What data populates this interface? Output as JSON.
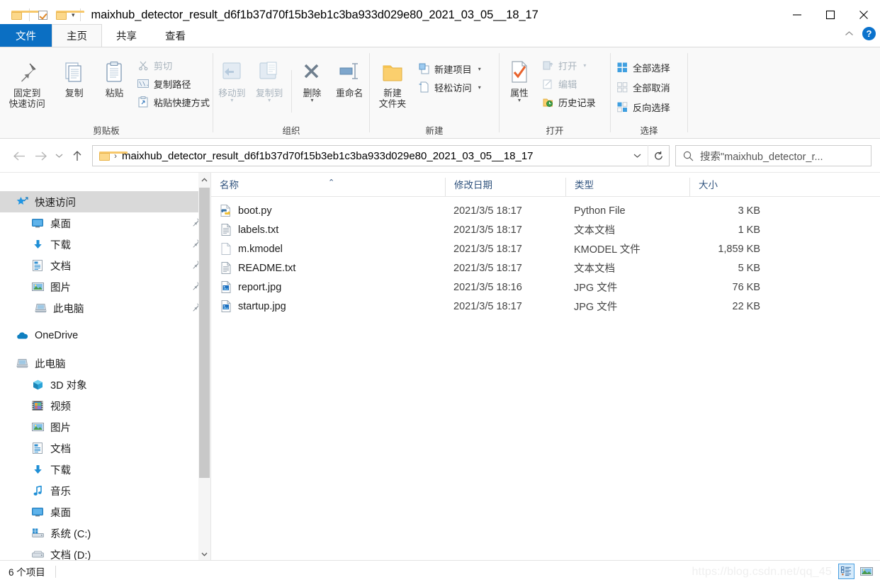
{
  "window": {
    "title": "maixhub_detector_result_d6f1b37d70f15b3eb1c3ba933d029e80_2021_03_05__18_17",
    "minimize_label": "—",
    "maximize_label": "□",
    "close_label": "✕"
  },
  "quick_access_toolbar": {
    "properties_icon": "folder-icon",
    "new_folder_icon": "checkbox-icon",
    "second_folder_icon": "folder-icon",
    "customize_caret": "▾"
  },
  "ribbon_tabs": [
    {
      "label": "文件",
      "id": "file"
    },
    {
      "label": "主页",
      "id": "home"
    },
    {
      "label": "共享",
      "id": "share"
    },
    {
      "label": "查看",
      "id": "view"
    }
  ],
  "ribbon_right": {
    "collapse_icon": "chevron-up-icon",
    "help_label": "?"
  },
  "ribbon": {
    "groups": [
      {
        "id": "clipboard",
        "label": "剪贴板",
        "big_buttons": [
          {
            "label": "固定到\n快速访问",
            "line1": "固定到",
            "line2": "快速访问",
            "icon": "pin-icon",
            "disabled": false
          },
          {
            "label": "复制",
            "line1": "复制",
            "line2": "",
            "icon": "copy-icon",
            "disabled": false
          },
          {
            "label": "粘贴",
            "line1": "粘贴",
            "line2": "",
            "icon": "paste-icon",
            "disabled": false
          }
        ],
        "small_buttons": [
          {
            "label": "剪切",
            "icon": "scissors-icon",
            "disabled": true
          },
          {
            "label": "复制路径",
            "icon": "copy-path-icon",
            "disabled": false
          },
          {
            "label": "粘贴快捷方式",
            "icon": "paste-shortcut-icon",
            "disabled": false
          }
        ]
      },
      {
        "id": "organize",
        "label": "组织",
        "big_buttons": [
          {
            "line1": "移动到",
            "line2": "",
            "icon": "move-to-icon",
            "disabled": true,
            "caret": true
          },
          {
            "line1": "复制到",
            "line2": "",
            "icon": "copy-to-icon",
            "disabled": true,
            "caret": true
          },
          {
            "line1": "删除",
            "line2": "",
            "icon": "delete-icon",
            "disabled": false,
            "caret": true
          },
          {
            "line1": "重命名",
            "line2": "",
            "icon": "rename-icon",
            "disabled": false,
            "caret": false
          }
        ],
        "small_buttons": []
      },
      {
        "id": "new",
        "label": "新建",
        "big_buttons": [
          {
            "line1": "新建",
            "line2": "文件夹",
            "icon": "new-folder-icon",
            "disabled": false
          }
        ],
        "small_buttons": [
          {
            "label": "新建项目",
            "icon": "new-item-icon",
            "disabled": false,
            "caret": true
          },
          {
            "label": "轻松访问",
            "icon": "easy-access-icon",
            "disabled": false,
            "caret": true
          }
        ]
      },
      {
        "id": "open",
        "label": "打开",
        "big_buttons": [
          {
            "line1": "属性",
            "line2": "",
            "icon": "properties-icon",
            "disabled": false,
            "caret": true
          }
        ],
        "small_buttons": [
          {
            "label": "打开",
            "icon": "open-icon",
            "disabled": true,
            "caret": true
          },
          {
            "label": "编辑",
            "icon": "edit-icon",
            "disabled": true
          },
          {
            "label": "历史记录",
            "icon": "history-icon",
            "disabled": false
          }
        ]
      },
      {
        "id": "select",
        "label": "选择",
        "big_buttons": [],
        "small_buttons": [
          {
            "label": "全部选择",
            "icon": "select-all-icon",
            "disabled": false
          },
          {
            "label": "全部取消",
            "icon": "select-none-icon",
            "disabled": false
          },
          {
            "label": "反向选择",
            "icon": "invert-selection-icon",
            "disabled": false
          }
        ]
      }
    ]
  },
  "addressbar": {
    "back_icon": "arrow-left-icon",
    "forward_icon": "arrow-right-icon",
    "recent_icon": "chevron-down-icon",
    "up_icon": "arrow-up-icon",
    "path_icon": "folder-icon",
    "separator": "›",
    "path": "maixhub_detector_result_d6f1b37d70f15b3eb1c3ba933d029e80_2021_03_05__18_17",
    "dropdown_icon": "chevron-down-icon",
    "refresh_icon": "refresh-icon"
  },
  "search": {
    "icon": "search-icon",
    "placeholder": "搜索\"maixhub_detector_r..."
  },
  "sidebar": {
    "groups": [
      {
        "header": {
          "label": "快速访问",
          "icon": "star-pin-icon",
          "selected": true
        },
        "items": [
          {
            "label": "桌面",
            "icon": "desktop-icon",
            "pinned": true
          },
          {
            "label": "下载",
            "icon": "download-icon",
            "pinned": true
          },
          {
            "label": "文档",
            "icon": "documents-icon",
            "pinned": true
          },
          {
            "label": "图片",
            "icon": "pictures-icon",
            "pinned": true
          },
          {
            "label": "此电脑",
            "icon": "this-pc-icon",
            "pinned": true
          }
        ]
      },
      {
        "header": {
          "label": "OneDrive",
          "icon": "onedrive-icon",
          "selected": false
        },
        "items": []
      },
      {
        "header": {
          "label": "此电脑",
          "icon": "this-pc-icon",
          "selected": false
        },
        "items": [
          {
            "label": "3D 对象",
            "icon": "3d-objects-icon",
            "pinned": false
          },
          {
            "label": "视频",
            "icon": "videos-icon",
            "pinned": false
          },
          {
            "label": "图片",
            "icon": "pictures-icon",
            "pinned": false
          },
          {
            "label": "文档",
            "icon": "documents-icon",
            "pinned": false
          },
          {
            "label": "下载",
            "icon": "download-icon",
            "pinned": false
          },
          {
            "label": "音乐",
            "icon": "music-icon",
            "pinned": false
          },
          {
            "label": "桌面",
            "icon": "desktop-icon",
            "pinned": false
          },
          {
            "label": "系统 (C:)",
            "icon": "system-drive-icon",
            "pinned": false
          },
          {
            "label": "文档 (D:)",
            "icon": "drive-icon",
            "pinned": false
          }
        ]
      }
    ]
  },
  "filelist": {
    "columns": [
      {
        "label": "名称",
        "sorted": true,
        "sort_icon": "⌃"
      },
      {
        "label": "修改日期",
        "sorted": false
      },
      {
        "label": "类型",
        "sorted": false
      },
      {
        "label": "大小",
        "sorted": false
      }
    ],
    "rows": [
      {
        "name": "boot.py",
        "date": "2021/3/5 18:17",
        "type": "Python File",
        "size": "3 KB",
        "icon": "python-file-icon"
      },
      {
        "name": "labels.txt",
        "date": "2021/3/5 18:17",
        "type": "文本文档",
        "size": "1 KB",
        "icon": "text-file-icon"
      },
      {
        "name": "m.kmodel",
        "date": "2021/3/5 18:17",
        "type": "KMODEL 文件",
        "size": "1,859 KB",
        "icon": "blank-file-icon"
      },
      {
        "name": "README.txt",
        "date": "2021/3/5 18:17",
        "type": "文本文档",
        "size": "5 KB",
        "icon": "text-file-icon"
      },
      {
        "name": "report.jpg",
        "date": "2021/3/5 18:16",
        "type": "JPG 文件",
        "size": "76 KB",
        "icon": "image-file-icon"
      },
      {
        "name": "startup.jpg",
        "date": "2021/3/5 18:17",
        "type": "JPG 文件",
        "size": "22 KB",
        "icon": "image-file-icon"
      }
    ]
  },
  "statusbar": {
    "item_count": "6 个项目",
    "watermark": "https://blog.csdn.net/qq_45",
    "view_details_icon": "details-view-icon",
    "view_thumbnails_icon": "thumbnail-view-icon"
  },
  "colors": {
    "accent": "#0b6fc3",
    "file_tab": "#0b6fc3",
    "column_header_text": "#30537e",
    "selected_nav": "#d9d9d9",
    "ribbon_bg": "#f9f9f9"
  }
}
